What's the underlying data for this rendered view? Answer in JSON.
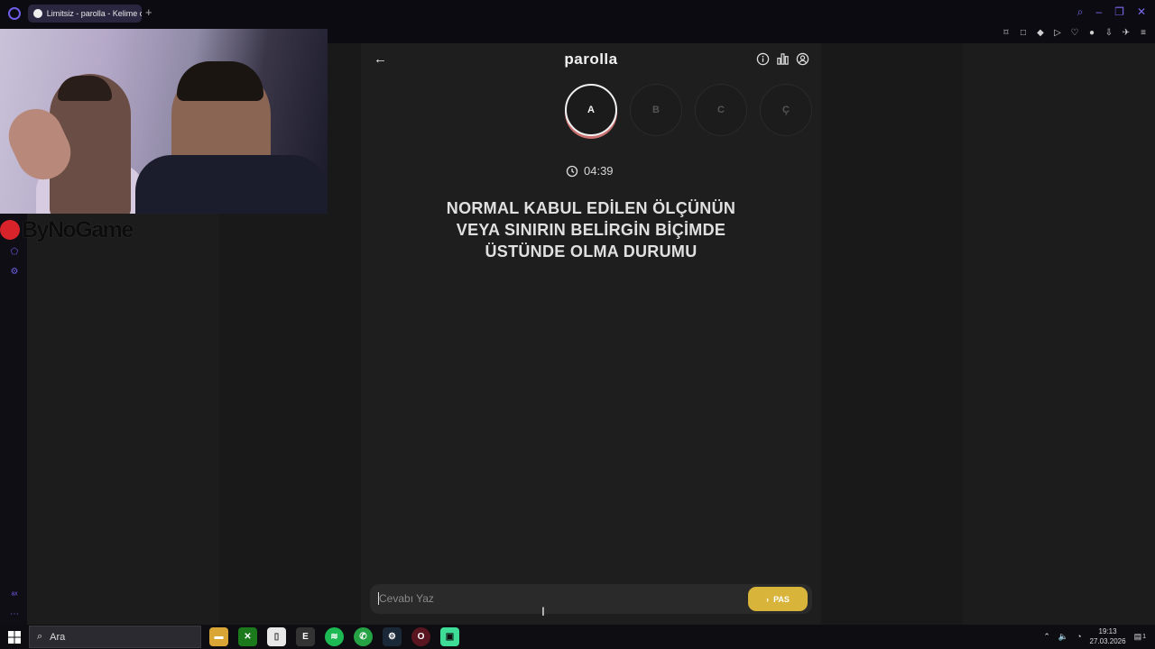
{
  "browser": {
    "tab_title": "Limitsiz - parolla - Kelime o",
    "new_tab_symbol": "+"
  },
  "overlay": {
    "brand_text": "ByNoGame"
  },
  "game": {
    "title": "parolla",
    "letters": [
      {
        "label": "A",
        "state": "active"
      },
      {
        "label": "B",
        "state": "inactive"
      },
      {
        "label": "C",
        "state": "inactive"
      },
      {
        "label": "Ç",
        "state": "inactive"
      }
    ],
    "timer": "04:39",
    "question_lines": [
      "NORMAL KABUL EDİLEN ÖLÇÜNÜN",
      "VEYA SINIRIN BELİRGİN BİÇİMDE",
      "ÜSTÜNDE OLMA DURUMU"
    ],
    "answer_placeholder": "Cevabı Yaz",
    "pass_label": "PAS"
  },
  "taskbar": {
    "search_label": "Ara",
    "time": "19:13",
    "date": "27.03.2026",
    "notification_count": "1",
    "apps": [
      "file-explorer-icon",
      "xbox-icon",
      "notes-icon",
      "epic-games-icon",
      "spotify-icon",
      "whatsapp-icon",
      "steam-icon",
      "opera-icon",
      "emulator-icon"
    ]
  },
  "colors": {
    "accent": "#6d5ee8",
    "pass_button": "#d9b43b",
    "active_ring_shadow": "#c97070",
    "background": "#1e1e1e"
  }
}
